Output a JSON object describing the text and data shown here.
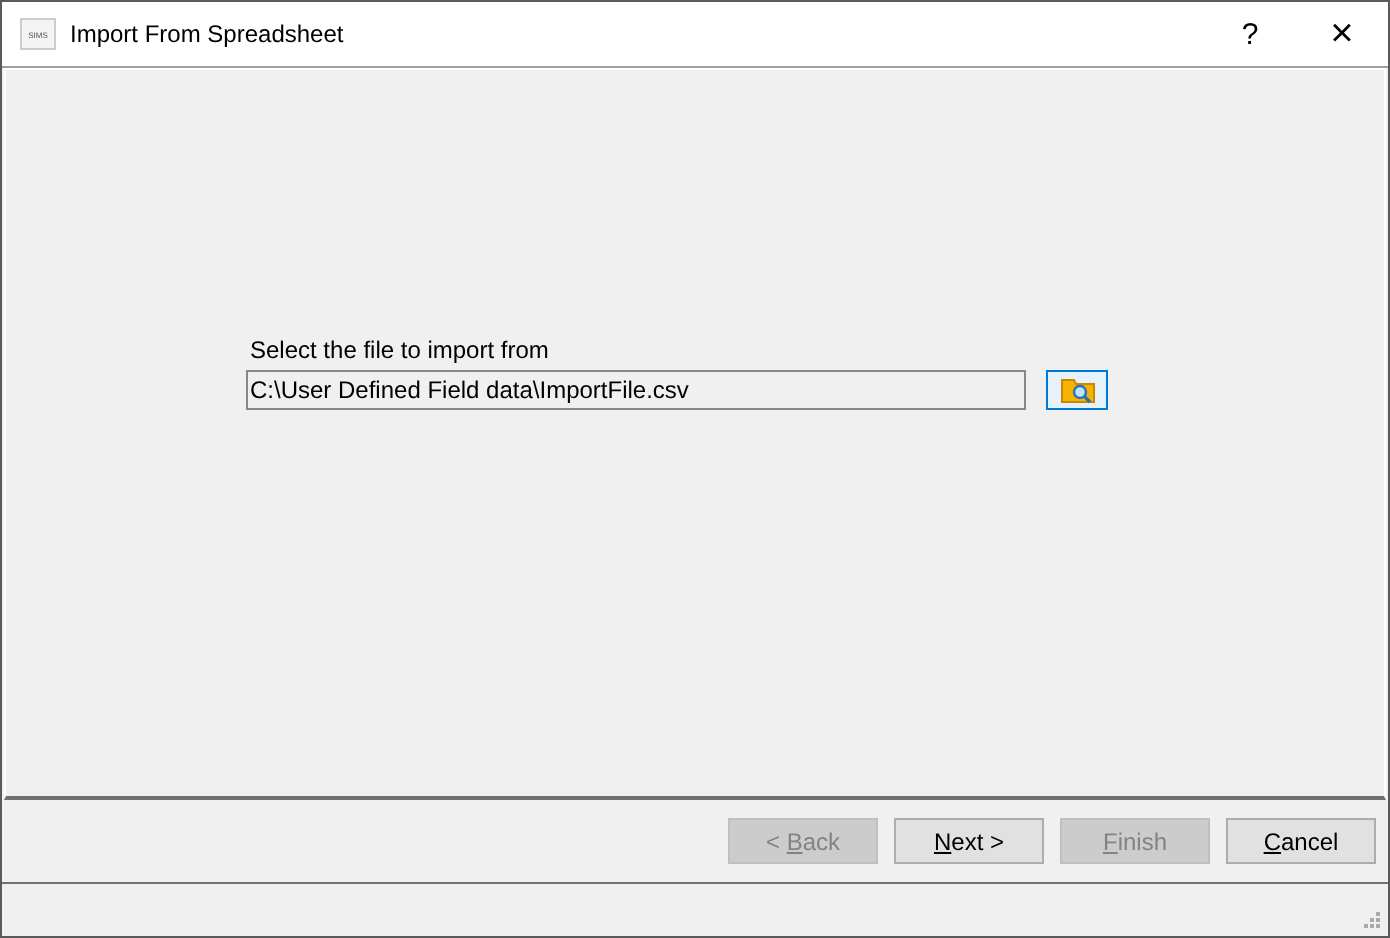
{
  "window": {
    "title": "Import From Spreadsheet",
    "app_icon_text": "SIMS",
    "help": "?",
    "close": "×"
  },
  "file_picker": {
    "label": "Select the file to import from",
    "value": "C:\\User Defined Field data\\ImportFile.csv"
  },
  "buttons": [
    {
      "before": "< ",
      "key": "B",
      "after": "ack",
      "disabled": true
    },
    {
      "key": "N",
      "after": "ext >",
      "disabled": false
    },
    {
      "key": "F",
      "after": "inish",
      "disabled": true
    },
    {
      "key": "C",
      "after": "ancel",
      "disabled": false
    }
  ]
}
